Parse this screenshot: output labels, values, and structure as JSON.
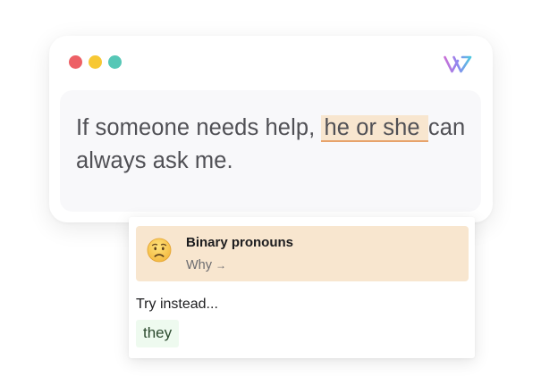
{
  "window": {
    "controls": [
      {
        "name": "close",
        "color": "#ed6066"
      },
      {
        "name": "minimize",
        "color": "#f7c834"
      },
      {
        "name": "zoom",
        "color": "#56c7b6"
      }
    ],
    "logo_icon": "brand-logo-icon"
  },
  "editor": {
    "text_before": "If someone needs help, ",
    "flagged_text": "he or she ",
    "text_after": "can always ask me.",
    "flag_color": "#f8e6cf",
    "flag_underline_color": "#e7a36b"
  },
  "suggestion": {
    "emoji_icon": "worried-face-icon",
    "issue_title": "Binary pronouns",
    "why_label": "Why",
    "why_arrow": "→",
    "try_label": "Try instead...",
    "replacement": "they",
    "issue_bg": "#f8e6cf",
    "replacement_bg": "#eefaef"
  }
}
